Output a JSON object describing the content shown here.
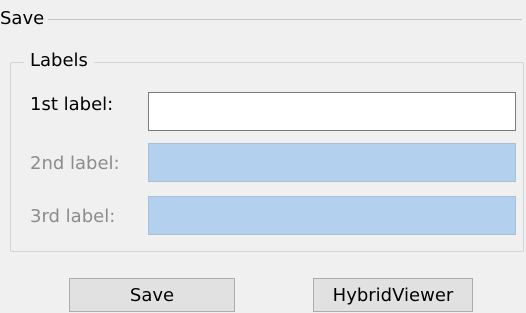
{
  "save_group": {
    "title": "Save"
  },
  "labels_group": {
    "title": "Labels",
    "rows": [
      {
        "label": "1st label:",
        "value": "",
        "enabled": true
      },
      {
        "label": "2nd label:",
        "value": "",
        "enabled": false
      },
      {
        "label": "3rd label:",
        "value": "",
        "enabled": false
      }
    ]
  },
  "buttons": {
    "save_label": "Save",
    "hybrid_viewer_label": "HybridViewer"
  },
  "colors": {
    "background": "#f0f0f0",
    "disabled_field": "#b3d0ee",
    "disabled_text": "#8c8c8c"
  }
}
